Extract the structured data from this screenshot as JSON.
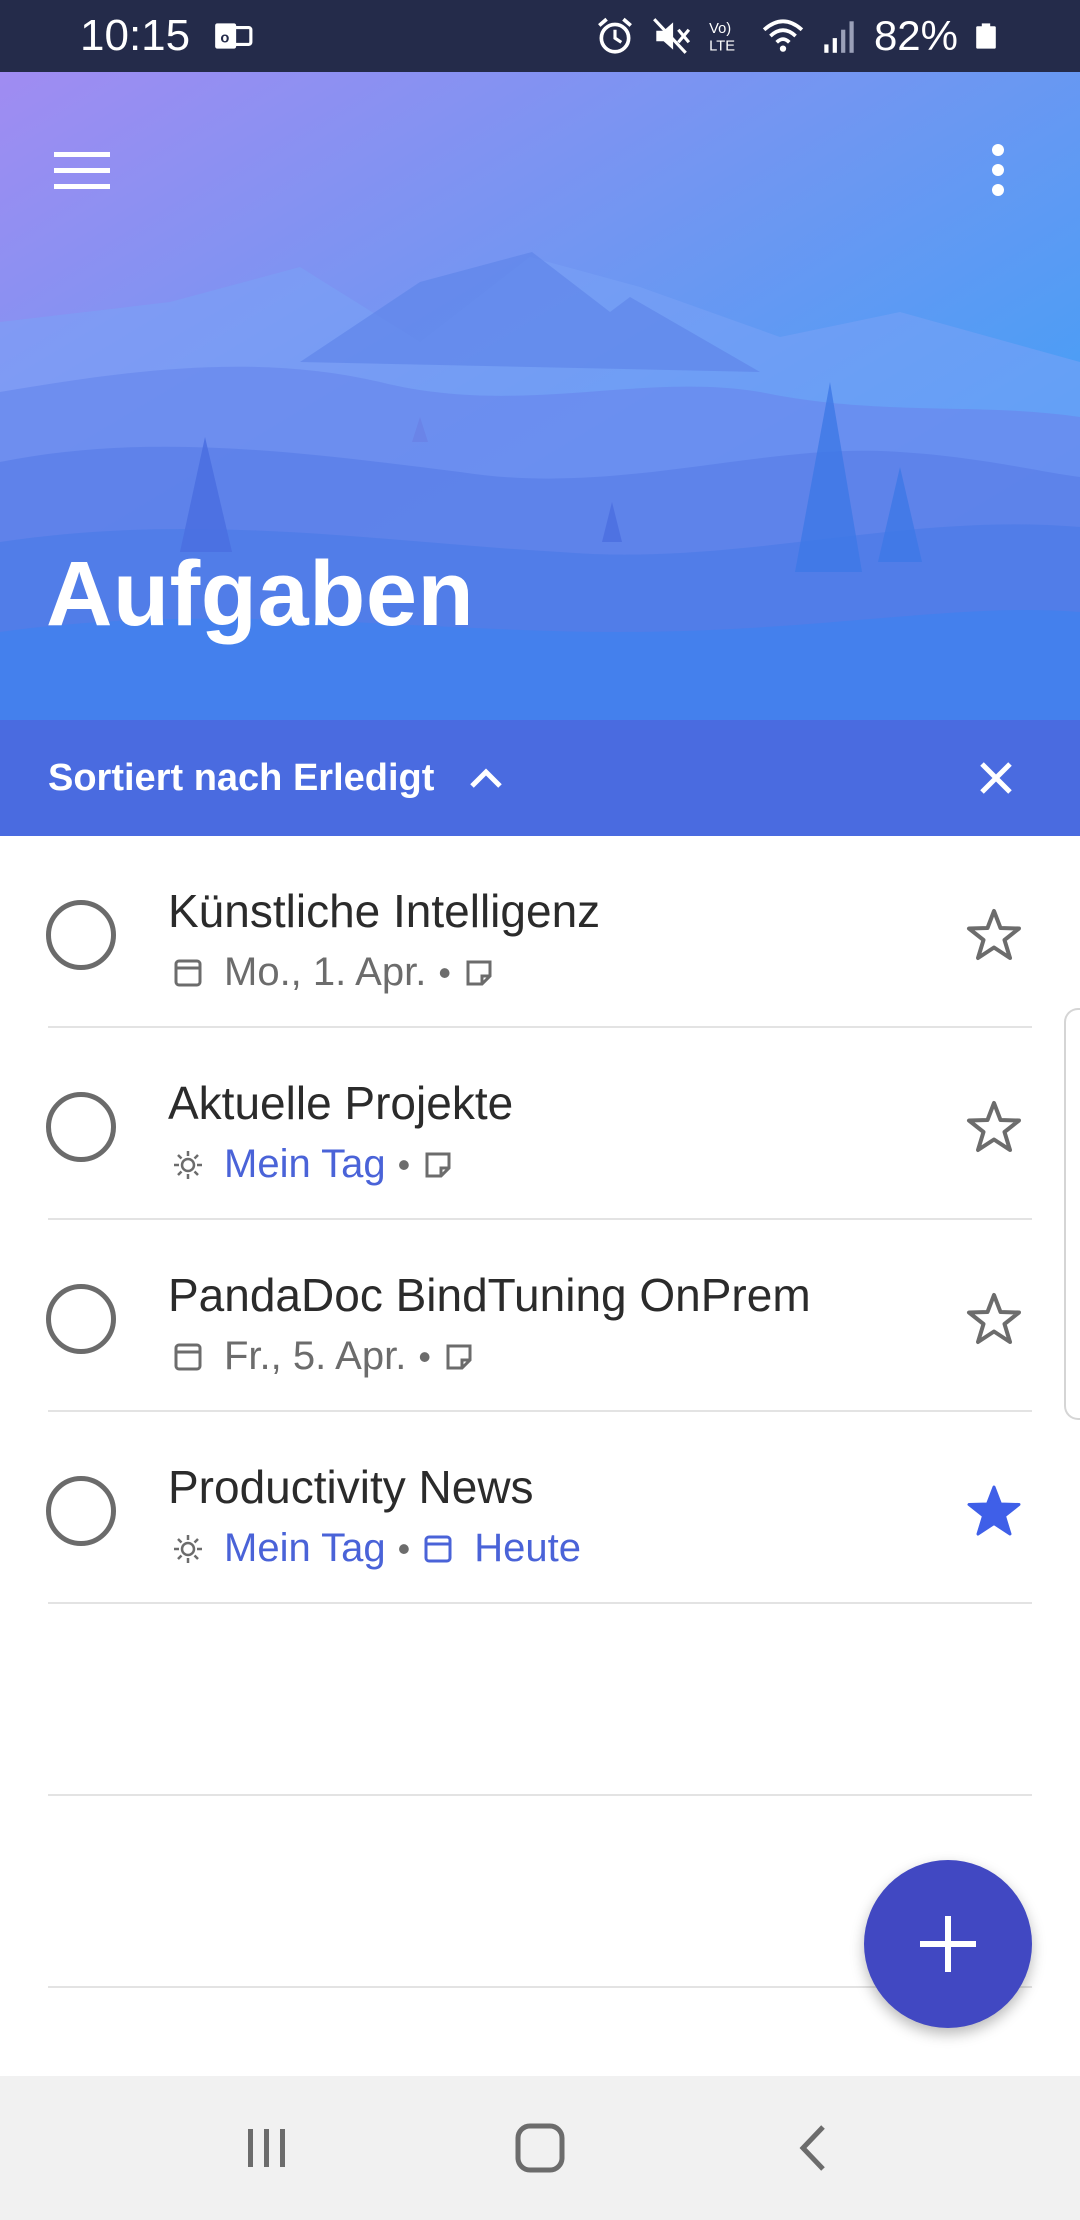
{
  "status_bar": {
    "time": "10:15",
    "battery": "82%",
    "icons": [
      "outlook-notification-icon",
      "alarm-icon",
      "mute-icon",
      "volte-icon",
      "wifi-icon",
      "signal-icon",
      "battery-icon"
    ]
  },
  "header": {
    "title": "Aufgaben",
    "menu_icon": "hamburger-menu-icon",
    "more_icon": "more-vertical-icon"
  },
  "sort_bar": {
    "label": "Sortiert nach Erledigt",
    "chevron_icon": "chevron-up-icon",
    "close_icon": "close-icon"
  },
  "tasks": [
    {
      "title": "Künstliche Intelligenz",
      "meta": [
        {
          "icon": "calendar-icon",
          "text": "Mo., 1. Apr.",
          "color": "gray"
        },
        {
          "icon": "note-icon",
          "text": "",
          "color": "gray"
        }
      ],
      "starred": false
    },
    {
      "title": "Aktuelle Projekte",
      "meta": [
        {
          "icon": "sun-icon",
          "text": "Mein Tag",
          "color": "blue"
        },
        {
          "icon": "note-icon",
          "text": "",
          "color": "gray"
        }
      ],
      "starred": false
    },
    {
      "title": "PandaDoc BindTuning OnPrem",
      "meta": [
        {
          "icon": "calendar-icon",
          "text": "Fr., 5. Apr.",
          "color": "gray"
        },
        {
          "icon": "note-icon",
          "text": "",
          "color": "gray"
        }
      ],
      "starred": false
    },
    {
      "title": "Productivity News",
      "meta": [
        {
          "icon": "sun-icon",
          "text": "Mein Tag",
          "color": "blue"
        },
        {
          "icon": "calendar-icon",
          "text": "Heute",
          "color": "blue"
        }
      ],
      "starred": true
    }
  ],
  "fab": {
    "icon": "add-icon"
  },
  "nav_bar": {
    "icons": [
      "recent-apps-icon",
      "home-icon",
      "back-icon"
    ]
  },
  "colors": {
    "status_bar": "#242b4a",
    "sort_bar": "#4a6be0",
    "accent_blue": "#4a63d8",
    "fab": "#4148c2",
    "star_filled": "#3f5fe8"
  }
}
